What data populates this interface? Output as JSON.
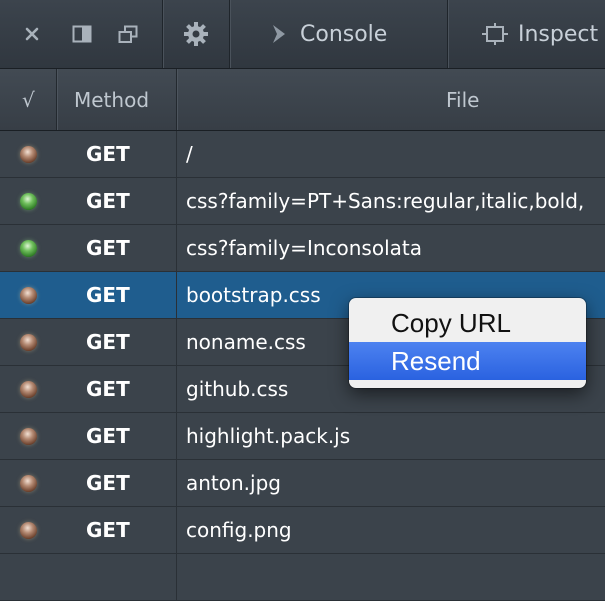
{
  "toolbar": {
    "close_icon": "close-icon",
    "dock_side_icon": "dock-side-icon",
    "undock_icon": "undock-icon",
    "settings_icon": "gear-icon",
    "console_label": "Console",
    "inspector_label": "Inspect"
  },
  "table": {
    "headers": {
      "status": "√",
      "method": "Method",
      "file": "File"
    },
    "rows": [
      {
        "status": "brown",
        "method": "GET",
        "file": "/"
      },
      {
        "status": "green",
        "method": "GET",
        "file": "css?family=PT+Sans:regular,italic,bold,"
      },
      {
        "status": "green",
        "method": "GET",
        "file": "css?family=Inconsolata"
      },
      {
        "status": "brown",
        "method": "GET",
        "file": "bootstrap.css",
        "selected": true
      },
      {
        "status": "brown",
        "method": "GET",
        "file": "noname.css"
      },
      {
        "status": "brown",
        "method": "GET",
        "file": "github.css"
      },
      {
        "status": "brown",
        "method": "GET",
        "file": "highlight.pack.js"
      },
      {
        "status": "brown",
        "method": "GET",
        "file": "anton.jpg"
      },
      {
        "status": "brown",
        "method": "GET",
        "file": "config.png"
      }
    ]
  },
  "context_menu": {
    "items": [
      {
        "label": "Copy URL",
        "highlighted": false
      },
      {
        "label": "Resend",
        "highlighted": true
      }
    ]
  },
  "colors": {
    "selected_row": "#1f5d8e",
    "menu_highlight": "#2a62e0"
  }
}
